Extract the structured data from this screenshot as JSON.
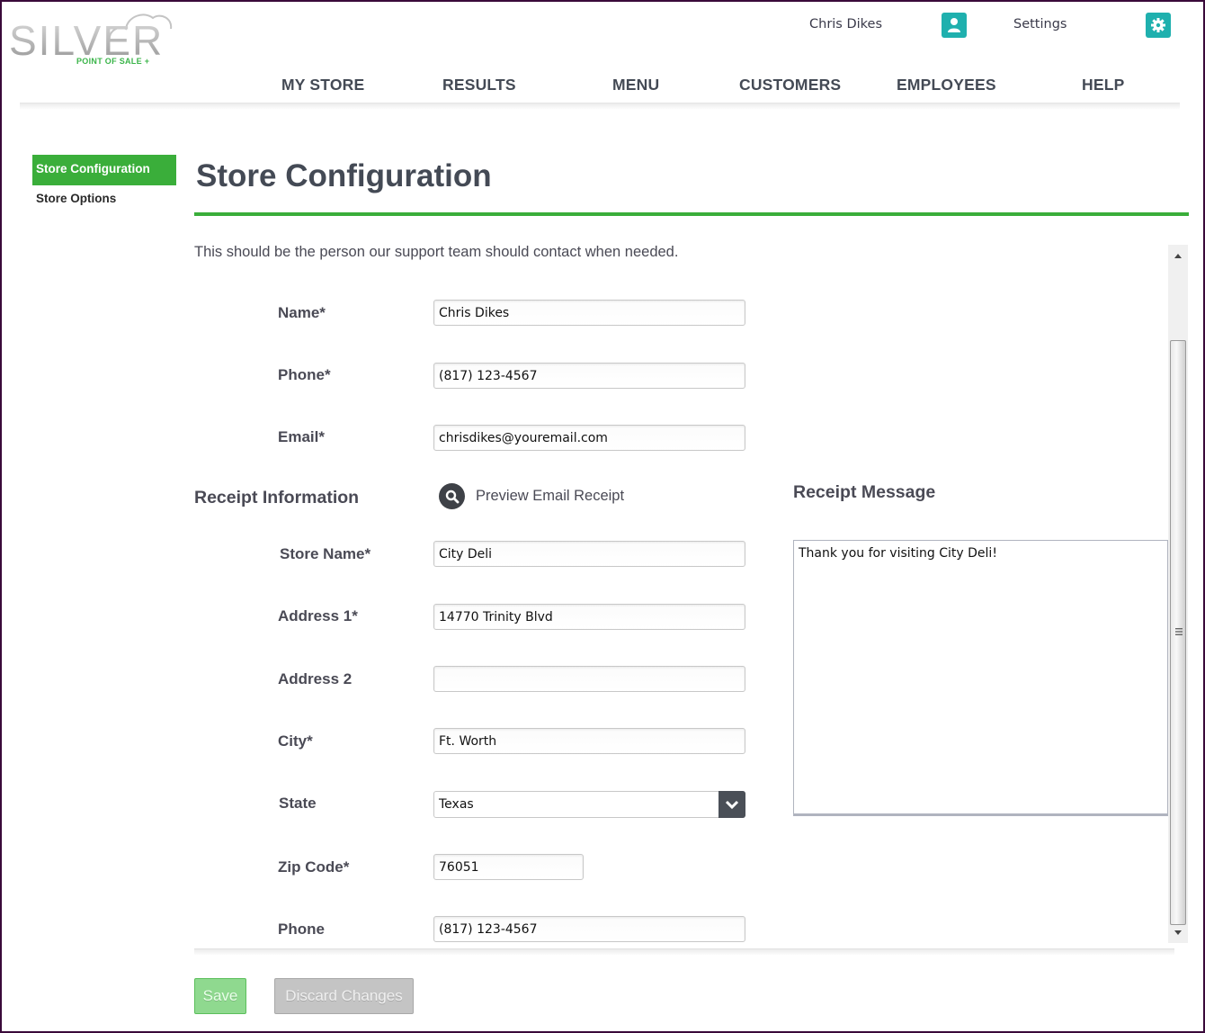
{
  "brand": {
    "name": "SILVER",
    "tagline": "POINT OF SALE +",
    "accent": "#3aae3a",
    "teal": "#1fb0ae"
  },
  "header": {
    "user_name": "Chris Dikes",
    "user_icon": "user-icon",
    "settings_label": "Settings",
    "settings_icon": "gear-icon"
  },
  "nav": {
    "items": [
      {
        "label": "MY STORE"
      },
      {
        "label": "RESULTS"
      },
      {
        "label": "MENU"
      },
      {
        "label": "CUSTOMERS"
      },
      {
        "label": "EMPLOYEES"
      },
      {
        "label": "HELP"
      }
    ]
  },
  "sidebar": {
    "items": [
      {
        "label": "Store Configuration",
        "active": true
      },
      {
        "label": "Store Options",
        "active": false
      }
    ]
  },
  "main": {
    "title": "Store Configuration",
    "intro": "This should be the person our support team should contact when needed.",
    "contact": {
      "name_label": "Name*",
      "name_value": "Chris Dikes",
      "phone_label": "Phone*",
      "phone_value": "(817) 123-4567",
      "email_label": "Email*",
      "email_value": "chrisdikes@youremail.com"
    },
    "receipt": {
      "heading": "Receipt Information",
      "preview_label": "Preview Email Receipt",
      "preview_icon": "search-icon",
      "store_name_label": "Store Name*",
      "store_name_value": "City Deli",
      "address1_label": "Address 1*",
      "address1_value": "14770 Trinity Blvd",
      "address2_label": "Address 2",
      "address2_value": "",
      "city_label": "City*",
      "city_value": "Ft. Worth",
      "state_label": "State",
      "state_value": "Texas",
      "zip_label": "Zip Code*",
      "zip_value": "76051",
      "phone_label": "Phone",
      "phone_value": "(817) 123-4567"
    },
    "message": {
      "heading": "Receipt Message",
      "value": "Thank you for visiting City Deli!"
    }
  },
  "footer": {
    "save_label": "Save",
    "discard_label": "Discard Changes"
  }
}
